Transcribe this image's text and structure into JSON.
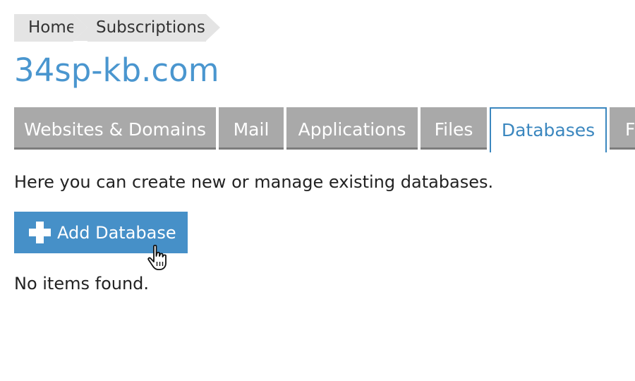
{
  "breadcrumb": {
    "items": [
      {
        "label": "Home"
      },
      {
        "label": "Subscriptions"
      }
    ]
  },
  "page": {
    "title": "34sp-kb.com",
    "description": "Here you can create new or manage existing databases.",
    "empty_text": "No items found."
  },
  "tabs": [
    {
      "label": "Websites & Domains",
      "active": false
    },
    {
      "label": "Mail",
      "active": false
    },
    {
      "label": "Applications",
      "active": false
    },
    {
      "label": "Files",
      "active": false
    },
    {
      "label": "Databases",
      "active": true
    },
    {
      "label": "F",
      "active": false
    }
  ],
  "toolbar": {
    "add_label": "Add Database",
    "add_icon": "plus-icon"
  },
  "colors": {
    "accent": "#4690c8",
    "title": "#4a96cf",
    "tab_inactive": "#a9a9a9",
    "breadcrumb_bg": "#e4e4e4"
  }
}
